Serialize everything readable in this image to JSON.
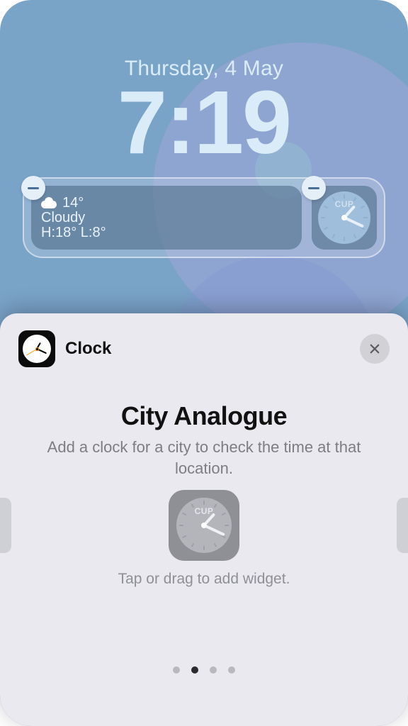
{
  "lockscreen": {
    "date": "Thursday, 4 May",
    "time": "7:19",
    "widgets": {
      "weather": {
        "temp": "14°",
        "condition": "Cloudy",
        "high_low": "H:18° L:8°"
      },
      "clock": {
        "city_code": "CUP"
      }
    }
  },
  "sheet": {
    "app_name": "Clock",
    "widget_title": "City Analogue",
    "widget_description": "Add a clock for a city to check the time at that location.",
    "preview_city_code": "CUP",
    "hint": "Tap or drag to add widget.",
    "page_index": 1,
    "page_count": 4
  }
}
